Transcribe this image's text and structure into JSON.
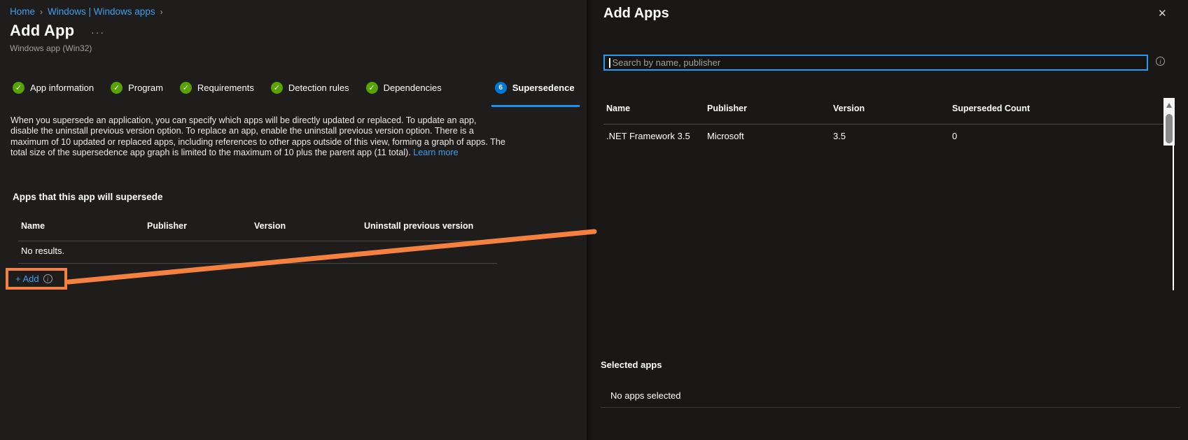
{
  "breadcrumb": {
    "separator": "›",
    "items": [
      {
        "label": "Home"
      },
      {
        "label": "Windows | Windows apps"
      }
    ]
  },
  "header": {
    "title": "Add App",
    "menu_ellipsis": "···",
    "subtitle": "Windows app (Win32)"
  },
  "wizard": {
    "steps": [
      {
        "label": "App information",
        "status": "complete",
        "icon": "check"
      },
      {
        "label": "Program",
        "status": "complete",
        "icon": "check"
      },
      {
        "label": "Requirements",
        "status": "complete",
        "icon": "check"
      },
      {
        "label": "Detection rules",
        "status": "complete",
        "icon": "check"
      },
      {
        "label": "Dependencies",
        "status": "complete",
        "icon": "check"
      },
      {
        "label": "Supersedence",
        "status": "current",
        "number": "6"
      }
    ],
    "check_glyph": "✓"
  },
  "description": {
    "text": "When you supersede an application, you can specify which apps will be directly updated or replaced. To update an app, disable the uninstall previous version option. To replace an app, enable the uninstall previous version option. There is a maximum of 10 updated or replaced apps, including references to other apps outside of this view, forming a graph of apps. The total size of the supersedence app graph is limited to the maximum of 10 plus the parent app (11 total).",
    "link_label": "Learn more"
  },
  "supersede_section": {
    "heading": "Apps that this app will supersede",
    "table": {
      "columns": [
        "Name",
        "Publisher",
        "Version",
        "Uninstall previous version"
      ],
      "empty_text": "No results."
    },
    "add_button": {
      "label": "+ Add",
      "info_glyph": "i"
    }
  },
  "panel": {
    "title": "Add Apps",
    "close_glyph": "✕",
    "search": {
      "placeholder": "Search by name, publisher",
      "value": "",
      "info_glyph": "i"
    },
    "table": {
      "columns": [
        "Name",
        "Publisher",
        "Version",
        "Superseded Count"
      ],
      "rows": [
        {
          "name": ".NET Framework 3.5",
          "publisher": "Microsoft",
          "version": "3.5",
          "superseded_count": "0"
        }
      ]
    },
    "selected": {
      "heading": "Selected apps",
      "empty_text": "No apps selected"
    }
  },
  "colors": {
    "link_blue": "#3f9ef0",
    "accent_blue": "#2899f5",
    "step_current_blue": "#0078d4",
    "success_green": "#57a300",
    "annotation_orange": "#f4813f",
    "background": "#1e1d1c",
    "panel_background": "#191817"
  }
}
